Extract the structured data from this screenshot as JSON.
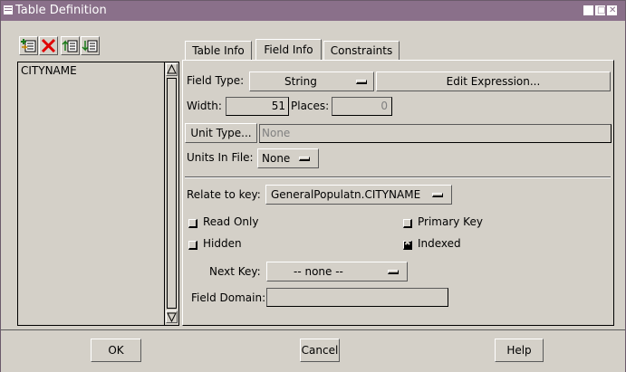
{
  "window": {
    "title": "Table Definition"
  },
  "toolbar": {
    "icons": [
      "add-field-icon",
      "delete-field-icon",
      "move-up-icon",
      "move-down-icon"
    ]
  },
  "fields_list": {
    "items": [
      "CITYNAME"
    ]
  },
  "tabs": [
    {
      "label": "Table Info",
      "active": false
    },
    {
      "label": "Field Info",
      "active": true
    },
    {
      "label": "Constraints",
      "active": false
    }
  ],
  "field_info": {
    "field_type_label": "Field Type:",
    "field_type_value": "String",
    "edit_expression_label": "Edit Expression...",
    "width_label": "Width:",
    "width_value": "51",
    "places_label": "Places:",
    "places_value": "0",
    "unit_type_button": "Unit Type...",
    "unit_type_value": "None",
    "units_in_file_label": "Units In File:",
    "units_in_file_value": "None",
    "relate_label": "Relate to key:",
    "relate_value": "GeneralPopulatn.CITYNAME",
    "read_only_label": "Read Only",
    "read_only_checked": false,
    "primary_key_label": "Primary Key",
    "primary_key_checked": false,
    "hidden_label": "Hidden",
    "hidden_checked": false,
    "indexed_label": "Indexed",
    "indexed_checked": true,
    "next_key_label": "Next Key:",
    "next_key_value": "-- none --",
    "field_domain_label": "Field Domain:",
    "field_domain_value": ""
  },
  "buttons": {
    "ok": "OK",
    "cancel": "Cancel",
    "help": "Help"
  },
  "colors": {
    "titlebar": "#8a708a",
    "face": "#d4d0c8"
  }
}
